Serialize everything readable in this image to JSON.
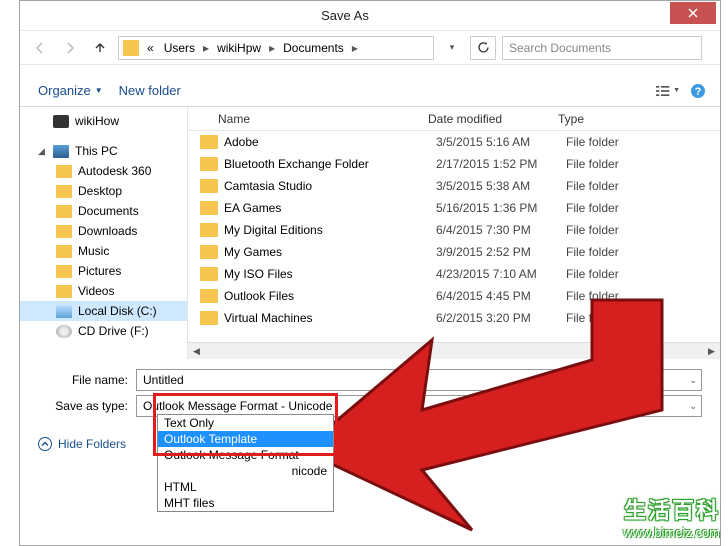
{
  "title": "Save As",
  "breadcrumb": {
    "lead": "«",
    "items": [
      "Users",
      "wikiHpw",
      "Documents"
    ]
  },
  "search": {
    "placeholder": "Search Documents"
  },
  "toolbar": {
    "organize": "Organize",
    "newfolder": "New folder"
  },
  "sidebar": {
    "top": "wikiHow",
    "pc": "This PC",
    "items": [
      "Autodesk 360",
      "Desktop",
      "Documents",
      "Downloads",
      "Music",
      "Pictures",
      "Videos"
    ],
    "drive": "Local Disk (C:)",
    "cd": "CD Drive (F:)"
  },
  "columns": {
    "name": "Name",
    "date": "Date modified",
    "type": "Type"
  },
  "files": [
    {
      "name": "Adobe",
      "date": "3/5/2015 5:16 AM",
      "type": "File folder"
    },
    {
      "name": "Bluetooth Exchange Folder",
      "date": "2/17/2015 1:52 PM",
      "type": "File folder"
    },
    {
      "name": "Camtasia Studio",
      "date": "3/5/2015 5:38 AM",
      "type": "File folder"
    },
    {
      "name": "EA Games",
      "date": "5/16/2015 1:36 PM",
      "type": "File folder"
    },
    {
      "name": "My Digital Editions",
      "date": "6/4/2015 7:30 PM",
      "type": "File folder"
    },
    {
      "name": "My Games",
      "date": "3/9/2015 2:52 PM",
      "type": "File folder"
    },
    {
      "name": "My ISO Files",
      "date": "4/23/2015 7:10 AM",
      "type": "File folder"
    },
    {
      "name": "Outlook Files",
      "date": "6/4/2015 4:45 PM",
      "type": "File folder"
    },
    {
      "name": "Virtual Machines",
      "date": "6/2/2015 3:20 PM",
      "type": "File folder"
    }
  ],
  "form": {
    "filename_label": "File name:",
    "filename_value": "Untitled",
    "type_label": "Save as type:",
    "type_value": "Outlook Message Format - Unicode"
  },
  "dropdown": {
    "options": [
      "Text Only",
      "Outlook Template",
      "Outlook Message Format",
      "",
      "HTML",
      "MHT files"
    ],
    "partial_suffix": "nicode",
    "selected_index": 1
  },
  "footer": {
    "hide": "Hide Folders"
  },
  "watermark": {
    "cn": "生活百科",
    "url": "www.bimeiz.com"
  }
}
